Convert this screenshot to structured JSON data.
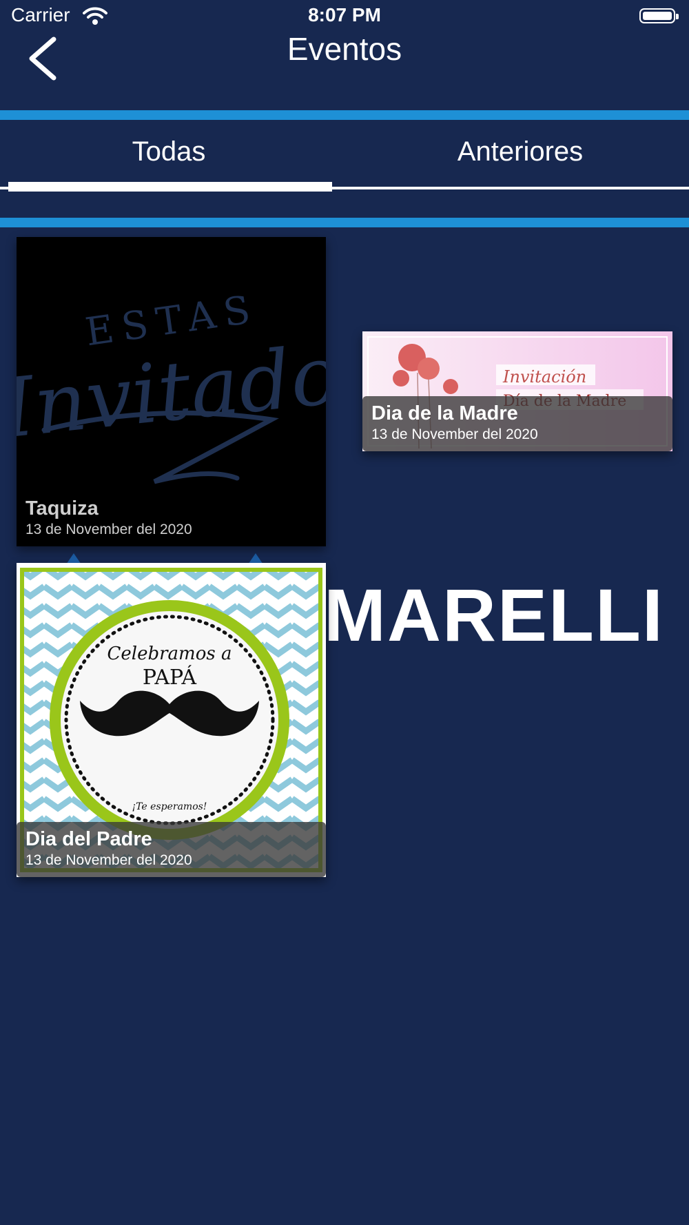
{
  "status_bar": {
    "carrier": "Carrier",
    "time": "8:07 PM"
  },
  "nav": {
    "title": "Eventos",
    "back_icon": "chevron-left-icon"
  },
  "tabs": [
    {
      "label": "Todas",
      "selected": true
    },
    {
      "label": "Anteriores",
      "selected": false
    }
  ],
  "background": {
    "brand_text": "MARELLI"
  },
  "events": [
    {
      "title": "Taquiza",
      "date": "13 de November del 2020",
      "image": {
        "line1": "ESTAS",
        "line2": "Invitado"
      }
    },
    {
      "title": "Dia de la Madre",
      "date": "13 de November del 2020",
      "image": {
        "line1": "Invitación",
        "line2": "Día de la Madre"
      }
    },
    {
      "title": "Dia del Padre",
      "date": "13 de November del 2020",
      "image": {
        "line1": "Celebramos a",
        "line2": "PAPÁ",
        "line3": "¡Te esperamos!"
      }
    }
  ],
  "colors": {
    "background": "#172850",
    "accent_stripe": "#1e90d6",
    "text": "#ffffff"
  }
}
